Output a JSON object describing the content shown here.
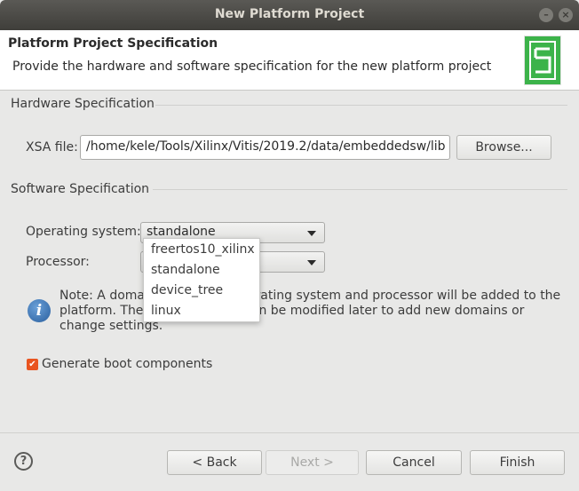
{
  "window": {
    "title": "New Platform Project"
  },
  "header": {
    "title": "Platform Project Specification",
    "description": "Provide the hardware and software specification for the new platform project"
  },
  "hardware": {
    "section_label": "Hardware Specification",
    "xsa_label": "XSA file:",
    "xsa_value": "/home/kele/Tools/Xilinx/Vitis/2019.2/data/embeddedsw/lib",
    "browse_label": "Browse..."
  },
  "software": {
    "section_label": "Software Specification",
    "os_label": "Operating system:",
    "os_selected": "standalone",
    "processor_label": "Processor:",
    "os_options": [
      "freertos10_xilinx",
      "standalone",
      "device_tree",
      "linux"
    ]
  },
  "note": {
    "line1_left": "Note: A domai",
    "line1_right": "erating system and processor will be added to the",
    "line2_left": "platform. The",
    "line2_right": "n be modified later to add new domains or",
    "line3": "change settings."
  },
  "options": {
    "generate_boot_label": "Generate boot components",
    "generate_boot_checked": true
  },
  "buttons": {
    "back": "< Back",
    "next": "Next >",
    "cancel": "Cancel",
    "finish": "Finish"
  },
  "colors": {
    "accent": "#e95420",
    "titlebar": "#3f3e3a",
    "logo_green": "#3cb34a"
  },
  "icons": [
    "close-icon",
    "minimize-icon",
    "info-icon",
    "help-icon",
    "checkbox-checked-icon",
    "platform-logo-icon",
    "dropdown-arrow-icon"
  ]
}
